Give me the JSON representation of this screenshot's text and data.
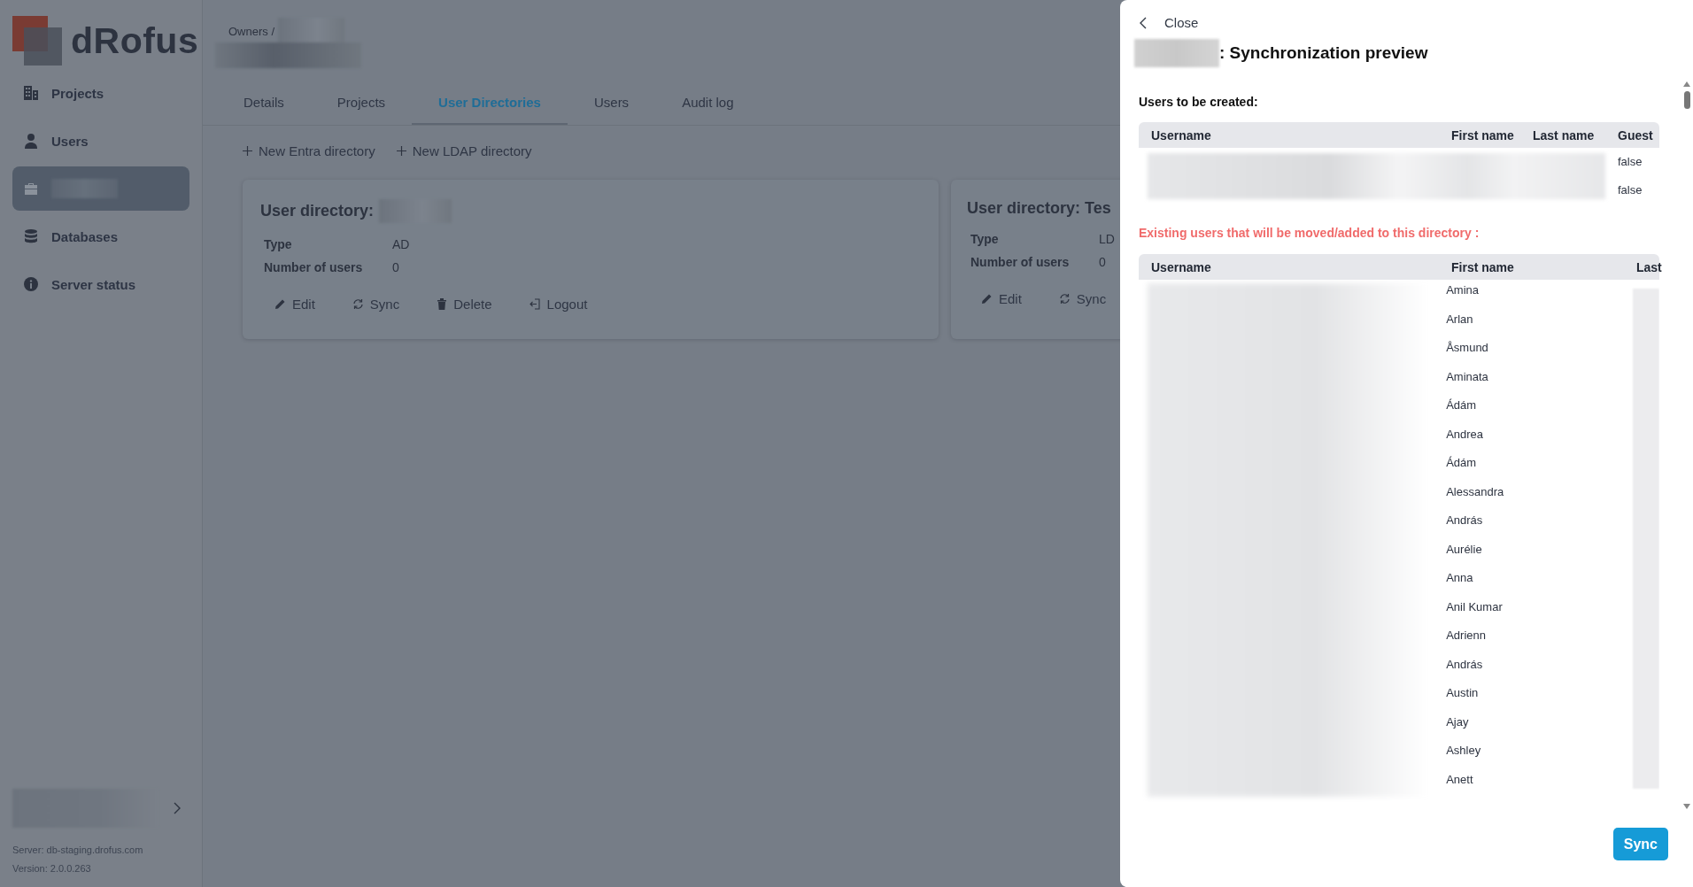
{
  "sidebar": {
    "logo": "dRofus",
    "items": [
      {
        "kind": "link",
        "label": "Projects",
        "selected": false
      },
      {
        "kind": "link",
        "label": "Users",
        "selected": false
      },
      {
        "kind": "redacted",
        "selected": true
      },
      {
        "kind": "link",
        "label": "Databases",
        "selected": false
      },
      {
        "kind": "link",
        "label": "Server status",
        "selected": false
      }
    ],
    "server": "Server: db-staging.drofus.com",
    "version": "Version: 2.0.0.263"
  },
  "breadcrumb": "Owners /",
  "tabs": [
    {
      "label": "Details",
      "selected": false
    },
    {
      "label": "Projects",
      "selected": false
    },
    {
      "label": "User Directories",
      "selected": true
    },
    {
      "label": "Users",
      "selected": false
    },
    {
      "label": "Audit log",
      "selected": false
    }
  ],
  "actions": [
    "New Entra directory",
    "New LDAP directory"
  ],
  "cards": [
    {
      "title": "User directory:",
      "redacted": true,
      "fields": [
        {
          "label": "Type",
          "value": "AD"
        },
        {
          "label": "Number of users",
          "value": "0"
        }
      ],
      "actions": [
        "Edit",
        "Sync",
        "Delete",
        "Logout"
      ]
    },
    {
      "title": "User directory: Tes",
      "redacted": false,
      "fields": [
        {
          "label": "Type",
          "value": "LD"
        },
        {
          "label": "Number of users",
          "value": "0"
        }
      ],
      "actions": [
        "Edit",
        "Sync"
      ]
    }
  ],
  "drawer": {
    "close": "Close",
    "title": ": Synchronization preview",
    "created": {
      "heading": "Users to be created:",
      "columns": [
        "Username",
        "First name",
        "Last name",
        "Guest"
      ],
      "rows": [
        {
          "guest": "false"
        },
        {
          "guest": "false"
        }
      ]
    },
    "existing": {
      "heading": "Existing users that will be moved/added to this directory :",
      "columns": [
        "Username",
        "First name",
        "Last"
      ],
      "first_names": [
        "Amina",
        "Arlan",
        "Åsmund",
        "Aminata",
        "Ádám",
        "Andrea",
        "Ádám",
        "Alessandra",
        "András",
        "Aurélie",
        "Anna",
        "Anil Kumar",
        "Adrienn",
        "András",
        "Austin",
        "Ajay",
        "Ashley",
        "Anett"
      ]
    },
    "sync_button": "Sync"
  }
}
